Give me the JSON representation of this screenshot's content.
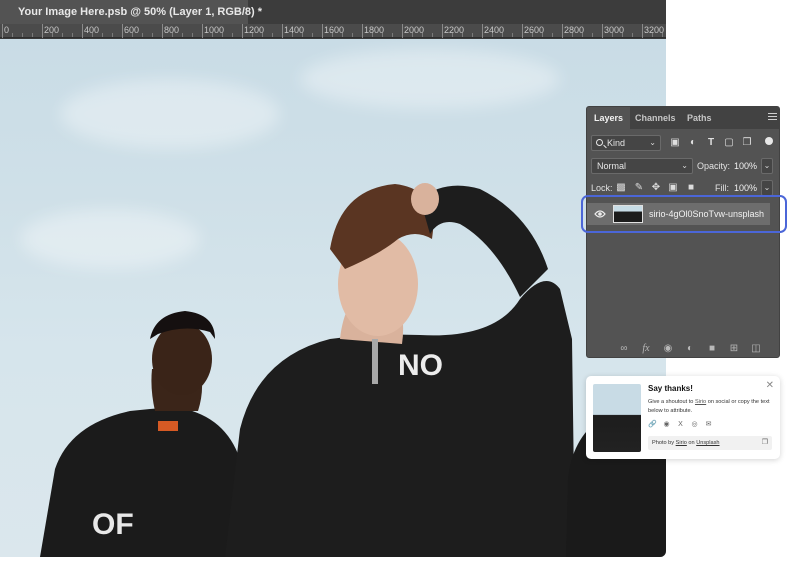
{
  "document": {
    "tab_title": "Your Image Here.psb @ 50% (Layer 1, RGB/8) *",
    "ruler_labels": [
      "0",
      "200",
      "400",
      "600",
      "800",
      "1000",
      "1200",
      "1400",
      "1600",
      "1800",
      "2000",
      "2200",
      "2400",
      "2600",
      "2800",
      "3000",
      "3200"
    ],
    "zoom": "50%"
  },
  "layers_panel": {
    "tabs": [
      {
        "label": "Layers",
        "active": true
      },
      {
        "label": "Channels",
        "active": false
      },
      {
        "label": "Paths",
        "active": false
      }
    ],
    "filter": {
      "kind_label": "Kind",
      "icons": [
        "image-filter-icon",
        "adjustment-filter-icon",
        "type-filter-icon",
        "shape-filter-icon",
        "smart-object-filter-icon"
      ]
    },
    "blend_mode": "Normal",
    "opacity_label": "Opacity:",
    "opacity_value": "100%",
    "lock_label": "Lock:",
    "fill_label": "Fill:",
    "fill_value": "100%",
    "layers": [
      {
        "name": "sirio-4gOl0SnoTvw-unsplash",
        "visible": true,
        "selected": true
      }
    ],
    "bottom_icons": [
      "link-layers-icon",
      "fx-icon",
      "mask-icon",
      "adjustment-icon",
      "group-folder-icon",
      "new-layer-icon",
      "trash-icon"
    ]
  },
  "thanks_card": {
    "title": "Say thanks!",
    "body_pre": "Give a shoutout to ",
    "author": "Sirio",
    "body_post": " on social or copy the text below to attribute.",
    "credit_pre": "Photo by ",
    "credit_author": "Sirio",
    "credit_mid": " on ",
    "credit_site": "Unsplash"
  },
  "colors": {
    "highlight": "#4b66d8",
    "panel_bg": "#535353",
    "sky": "#cfe0e8"
  }
}
